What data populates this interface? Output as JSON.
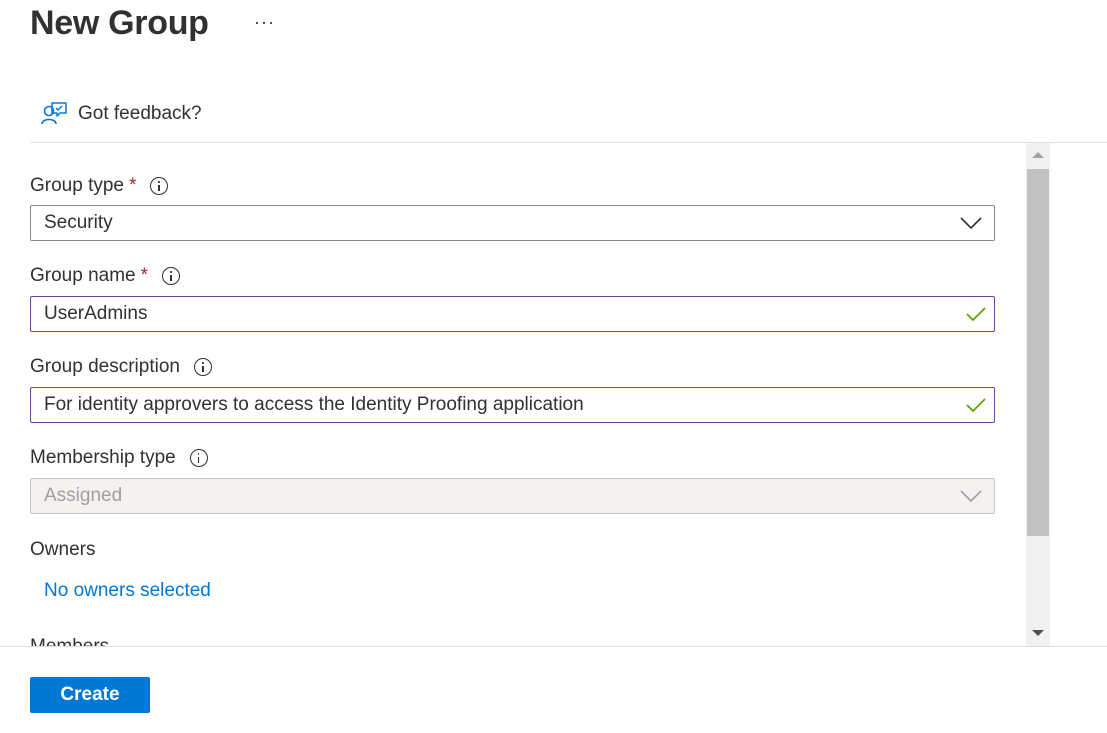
{
  "header": {
    "title": "New Group",
    "more_label": "···"
  },
  "feedback": {
    "label": "Got feedback?",
    "icon": "feedback-person-icon"
  },
  "form": {
    "group_type": {
      "label": "Group type",
      "required_mark": "*",
      "value": "Security",
      "icon": "chevron-down-icon"
    },
    "group_name": {
      "label": "Group name",
      "required_mark": "*",
      "value": "UserAdmins",
      "icon": "checkmark-icon"
    },
    "group_description": {
      "label": "Group description",
      "value": "For identity approvers to access the Identity Proofing application",
      "icon": "checkmark-icon"
    },
    "membership_type": {
      "label": "Membership type",
      "value": "Assigned",
      "disabled": true
    },
    "owners": {
      "label": "Owners",
      "link": "No owners selected"
    },
    "members": {
      "label": "Members"
    }
  },
  "footer": {
    "create_label": "Create"
  },
  "colors": {
    "accent": "#0078d4",
    "required": "#a4262c",
    "valid_check": "#57a300",
    "valid_border": "#7a3e9d"
  }
}
